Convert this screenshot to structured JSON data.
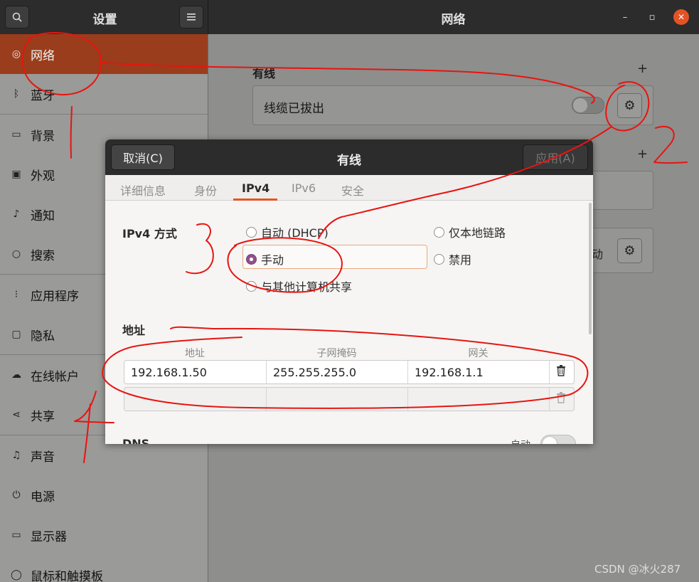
{
  "header": {
    "search_icon": "search-icon",
    "app_title": "设置",
    "menu_icon": "hamburger-menu-icon",
    "window_title": "网络",
    "min_icon": "minimize-icon",
    "max_icon": "maximize-icon",
    "close_icon": "close-icon",
    "min_glyph": "–",
    "max_glyph": "▫",
    "close_glyph": "✕"
  },
  "sidebar": {
    "items": [
      {
        "label": "网络",
        "icon": "globe-icon",
        "glyph": "◎",
        "active": true
      },
      {
        "label": "蓝牙",
        "icon": "bluetooth-icon",
        "glyph": "ᛒ"
      },
      {
        "label": "背景",
        "icon": "monitor-background-icon",
        "glyph": "▭"
      },
      {
        "label": "外观",
        "icon": "appearance-icon",
        "glyph": "▣"
      },
      {
        "label": "通知",
        "icon": "bell-icon",
        "glyph": "♪"
      },
      {
        "label": "搜索",
        "icon": "search-icon",
        "glyph": "○"
      },
      {
        "label": "应用程序",
        "icon": "apps-grid-icon",
        "glyph": "⁝"
      },
      {
        "label": "隐私",
        "icon": "lock-icon",
        "glyph": "▢"
      },
      {
        "label": "在线帐户",
        "icon": "cloud-icon",
        "glyph": "☁"
      },
      {
        "label": "共享",
        "icon": "share-icon",
        "glyph": "⋖"
      },
      {
        "label": "声音",
        "icon": "music-note-icon",
        "glyph": "♫"
      },
      {
        "label": "电源",
        "icon": "power-icon",
        "glyph": "⏻"
      },
      {
        "label": "显示器",
        "icon": "display-icon",
        "glyph": "▭"
      },
      {
        "label": "鼠标和触摸板",
        "icon": "mouse-icon",
        "glyph": "◯"
      }
    ]
  },
  "main": {
    "wired_section_title": "有线",
    "wired_add": "+",
    "wired_status": "线缆已拔出",
    "vpn_add": "+",
    "partial_label": "手动",
    "gear_glyph": "⚙"
  },
  "dialog": {
    "cancel_label": "取消(C)",
    "title": "有线",
    "apply_label": "应用(A)",
    "tabs": [
      "详细信息",
      "身份",
      "IPv4",
      "IPv6",
      "安全"
    ],
    "ipv4_method_label": "IPv4 方式",
    "methods": {
      "auto": "自动 (DHCP)",
      "link_local": "仅本地链路",
      "manual": "手动",
      "disabled": "禁用",
      "shared": "与其他计算机共享"
    },
    "selected_method": "手动",
    "address_section": "地址",
    "columns": [
      "地址",
      "子网掩码",
      "网关"
    ],
    "rows": [
      {
        "address": "192.168.1.50",
        "netmask": "255.255.255.0",
        "gateway": "192.168.1.1"
      }
    ],
    "trash_glyph": "🗑",
    "dns_label": "DNS",
    "dns_auto_label": "自动"
  },
  "watermark": "CSDN @冰火287",
  "annotation_color": "#e8140f"
}
